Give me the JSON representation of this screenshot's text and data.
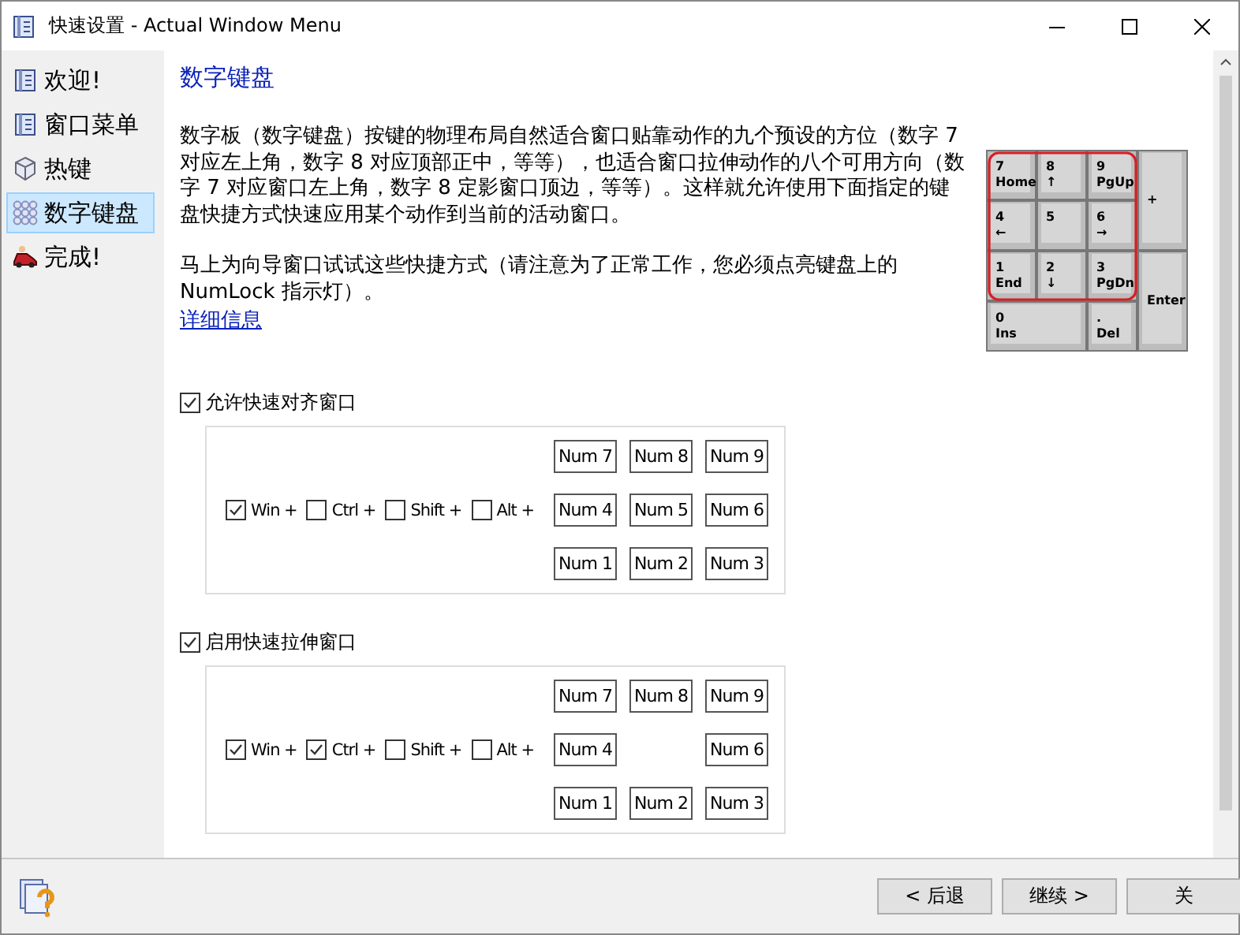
{
  "window": {
    "title": "快速设置 - Actual Window Menu"
  },
  "sidebar": {
    "items": [
      {
        "label": "欢迎!",
        "kind": "book",
        "selected": false
      },
      {
        "label": "窗口菜单",
        "kind": "book",
        "selected": false
      },
      {
        "label": "热键",
        "kind": "cube",
        "selected": false
      },
      {
        "label": "数字键盘",
        "kind": "keys",
        "selected": true
      },
      {
        "label": "完成!",
        "kind": "car",
        "selected": false
      }
    ]
  },
  "page": {
    "heading": "数字键盘",
    "paragraphs": [
      "数字板（数字键盘）按键的物理布局自然适合窗口贴靠动作的九个预设的方位（数字 7 对应左上角，数字 8 对应顶部正中，等等），也适合窗口拉伸动作的八个可用方向（数字 7 对应窗口左上角，数字 8 定影窗口顶边，等等）。这样就允许使用下面指定的键盘快捷方式快速应用某个动作到当前的活动窗口。",
      "马上为向导窗口试试这些快捷方式（请注意为了正常工作，您必须点亮键盘上的 NumLock 指示灯）。"
    ],
    "link": "详细信息",
    "keypad": [
      {
        "main": "7",
        "sub": "Home",
        "kind": "key"
      },
      {
        "main": "8",
        "sub": "↑",
        "kind": "key"
      },
      {
        "main": "9",
        "sub": "PgUp",
        "kind": "key"
      },
      {
        "main": "+",
        "kind": "tall"
      },
      {
        "main": "4",
        "sub": "←",
        "kind": "key"
      },
      {
        "main": "5",
        "kind": "key"
      },
      {
        "main": "6",
        "sub": "→",
        "kind": "key"
      },
      {
        "main": "1",
        "sub": "End",
        "kind": "key"
      },
      {
        "main": "2",
        "sub": "↓",
        "kind": "key"
      },
      {
        "main": "3",
        "sub": "PgDn",
        "kind": "key"
      },
      {
        "main": "Enter",
        "kind": "tall"
      },
      {
        "main": "0",
        "sub": "Ins",
        "kind": "wide"
      },
      {
        "main": ".",
        "sub": "Del",
        "kind": "key"
      }
    ],
    "groups": [
      {
        "label": "允许快速对齐窗口",
        "checked": true,
        "modifiers": [
          {
            "label": "Win +",
            "checked": true
          },
          {
            "label": "Ctrl +",
            "checked": false
          },
          {
            "label": "Shift +",
            "checked": false
          },
          {
            "label": "Alt +",
            "checked": false
          }
        ],
        "keys": [
          {
            "kind": "key",
            "label": "Num 7"
          },
          {
            "kind": "key",
            "label": "Num 8"
          },
          {
            "kind": "key",
            "label": "Num 9"
          },
          {
            "kind": "key",
            "label": "Num 4"
          },
          {
            "kind": "key",
            "label": "Num 5"
          },
          {
            "kind": "key",
            "label": "Num 6"
          },
          {
            "kind": "key",
            "label": "Num 1"
          },
          {
            "kind": "key",
            "label": "Num 2"
          },
          {
            "kind": "key",
            "label": "Num 3"
          }
        ]
      },
      {
        "label": "启用快速拉伸窗口",
        "checked": true,
        "modifiers": [
          {
            "label": "Win +",
            "checked": true
          },
          {
            "label": "Ctrl +",
            "checked": true
          },
          {
            "label": "Shift +",
            "checked": false
          },
          {
            "label": "Alt +",
            "checked": false
          }
        ],
        "keys": [
          {
            "kind": "key",
            "label": "Num 7"
          },
          {
            "kind": "key",
            "label": "Num 8"
          },
          {
            "kind": "key",
            "label": "Num 9"
          },
          {
            "kind": "key",
            "label": "Num 4"
          },
          {
            "kind": "gap"
          },
          {
            "kind": "key",
            "label": "Num 6"
          },
          {
            "kind": "key",
            "label": "Num 1"
          },
          {
            "kind": "key",
            "label": "Num 2"
          },
          {
            "kind": "key",
            "label": "Num 3"
          }
        ]
      }
    ]
  },
  "buttons": [
    "< 后退",
    "继续 >",
    "关"
  ]
}
